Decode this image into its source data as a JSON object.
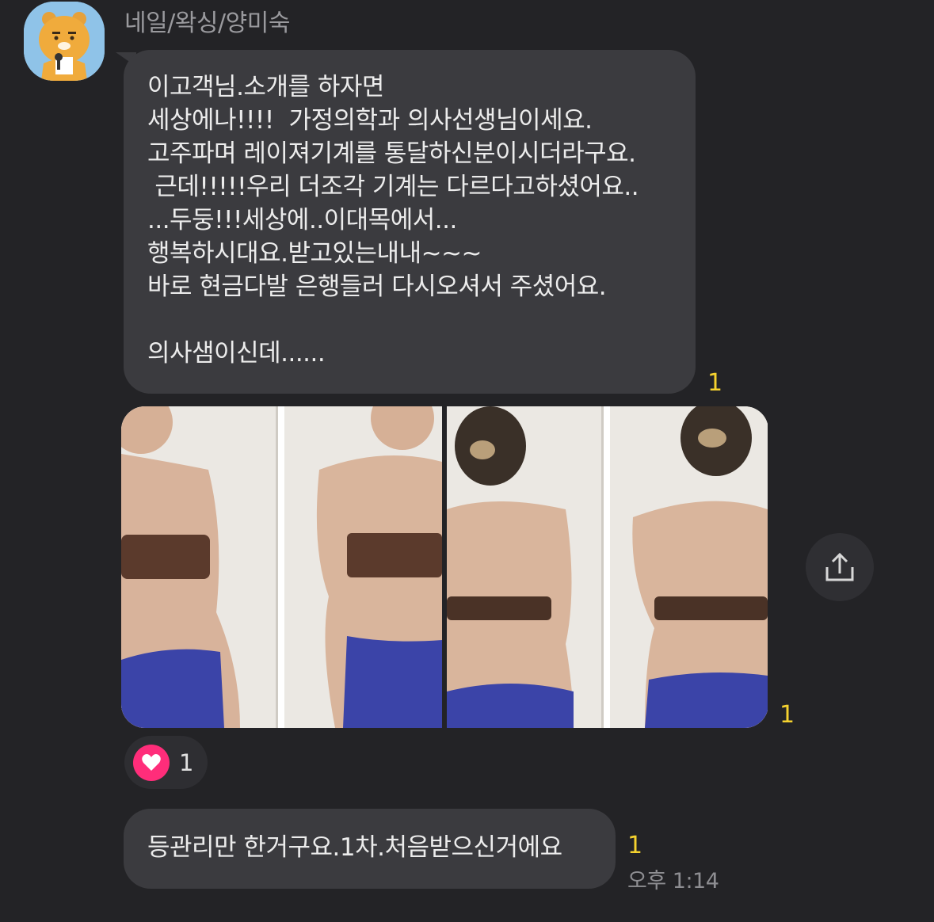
{
  "chat": {
    "sender_name": "네일/왁싱/양미숙",
    "message1_lines": [
      "이고객님.소개를 하자면",
      "세상에나!!!!  가정의학과 의사선생님이세요.",
      "고주파며 레이져기계를 통달하신분이시더라구요.",
      " 근데!!!!!우리 더조각 기계는 다르다고하셨어요..",
      "...두둥!!!세상에..이대목에서...",
      "행복하시대요.받고있는내내~~~",
      "바로 현금다발 은행들러 다시오셔서 주셨어요.",
      "",
      "의사샘이신데......"
    ],
    "message1_unread": "1",
    "photos_unread": "1",
    "reaction_count": "1",
    "message2_text": "등관리만 한거구요.1차.처음받으신거에요",
    "message2_unread": "1",
    "message2_time": "오후 1:14"
  },
  "icons": {
    "avatar": "ryan-character-avatar",
    "share": "share-upload-icon",
    "reaction": "heart-icon"
  },
  "colors": {
    "background": "#232326",
    "bubble": "#3b3b3f",
    "unread": "#f5d22f",
    "heart": "#ff2d7a"
  }
}
